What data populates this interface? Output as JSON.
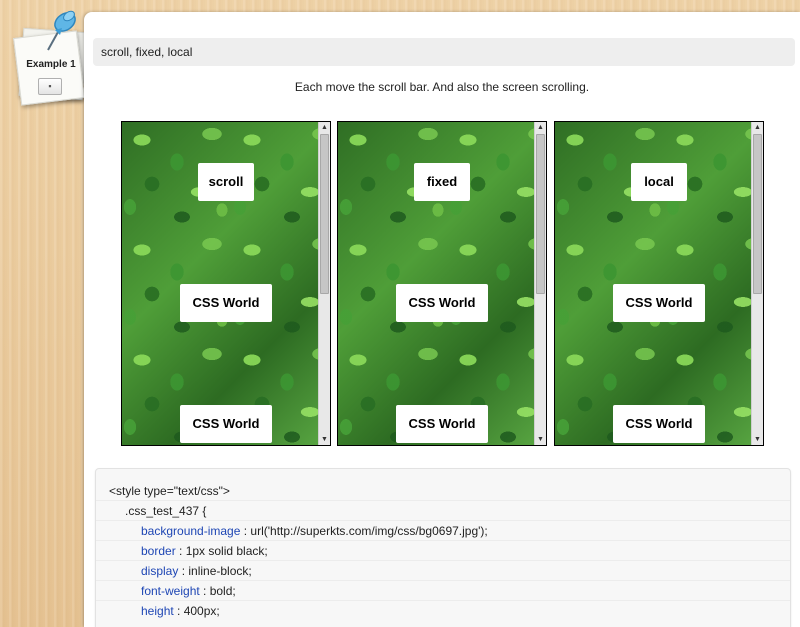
{
  "note": {
    "label": "Example 1",
    "button_label": "▪",
    "pin_icon": "pushpin-icon"
  },
  "main": {
    "title": "scroll, fixed, local",
    "description": "Each move the scroll bar. And also the screen scrolling.",
    "demos": [
      {
        "mode_label": "scroll",
        "text_1": "CSS World",
        "text_2": "CSS World"
      },
      {
        "mode_label": "fixed",
        "text_1": "CSS World",
        "text_2": "CSS World"
      },
      {
        "mode_label": "local",
        "text_1": "CSS World",
        "text_2": "CSS World"
      }
    ],
    "scroll_arrows": {
      "up": "▲",
      "down": "▼"
    }
  },
  "code": {
    "line_0": "<style type=\"text/css\">",
    "line_1": ".css_test_437 {",
    "lines": [
      {
        "prop": "background-image",
        "value": " : url('http://superkts.com/img/css/bg0697.jpg');"
      },
      {
        "prop": "border",
        "value": " : 1px solid black;"
      },
      {
        "prop": "display",
        "value": " : inline-block;"
      },
      {
        "prop": "font-weight",
        "value": " : bold;"
      },
      {
        "prop": "height",
        "value": " : 400px;"
      }
    ]
  },
  "colors": {
    "property": "#1e46b4",
    "leaf_green": "#3f8a2e",
    "panel": "#ffffff"
  }
}
